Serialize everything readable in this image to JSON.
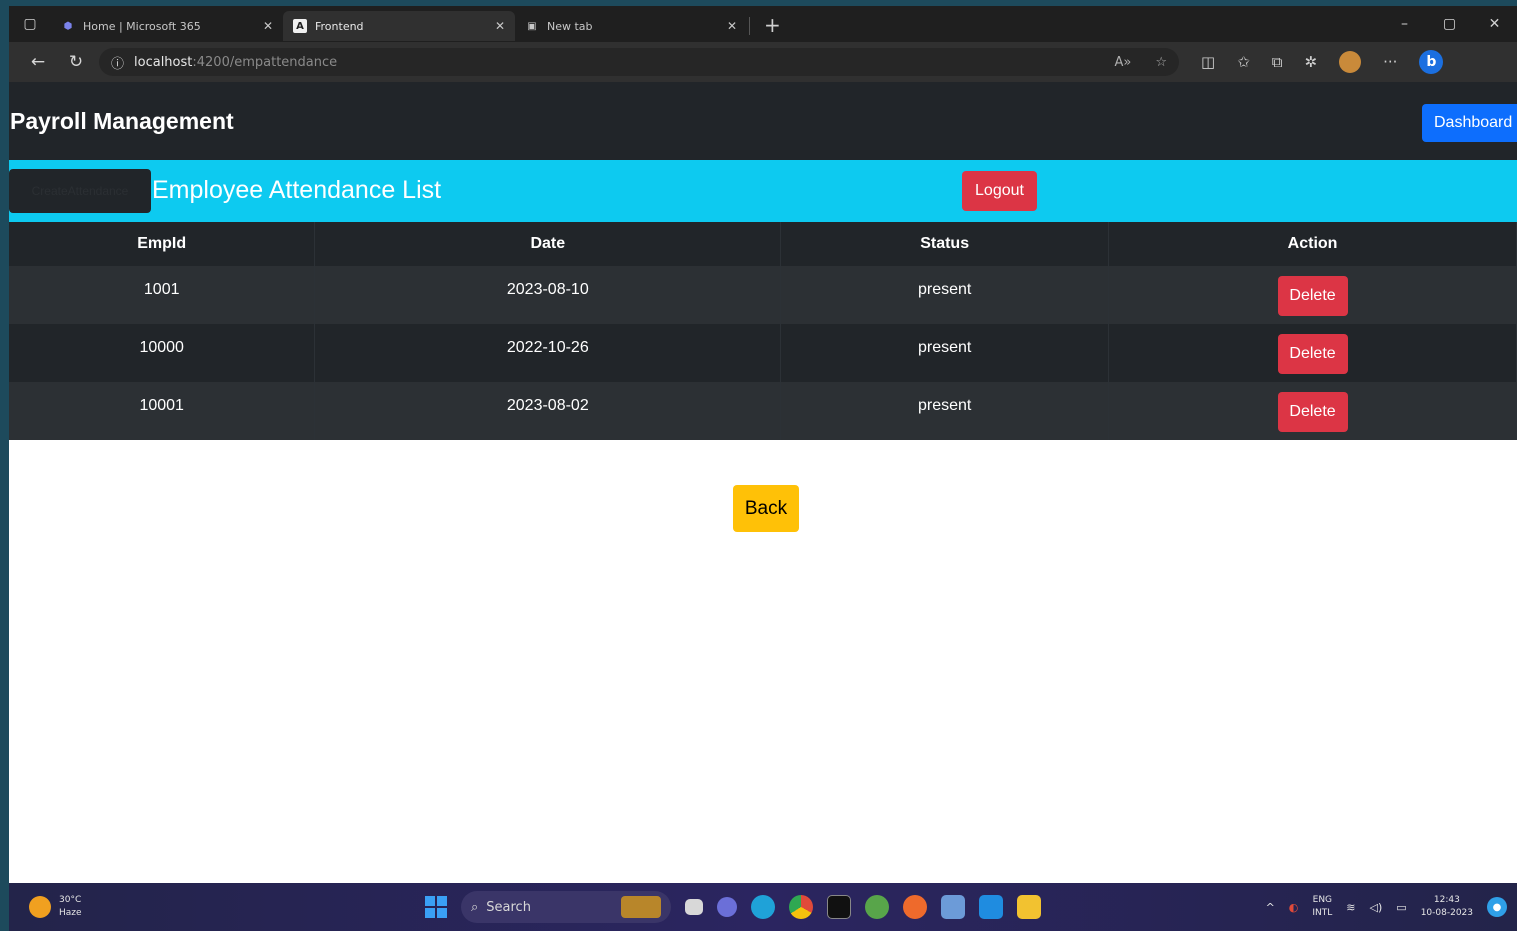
{
  "browser": {
    "tabs": [
      {
        "title": "Home | Microsoft 365",
        "active": false,
        "icon": "m365-icon"
      },
      {
        "title": "Frontend",
        "active": true,
        "icon": "angular-icon"
      },
      {
        "title": "New tab",
        "active": false,
        "icon": "newtab-icon"
      }
    ],
    "url_host": "localhost",
    "url_path": ":4200/empattendance"
  },
  "app": {
    "brand": "Payroll Management",
    "dashboard_label": "Dashboard",
    "create_label": "CreateAttendance",
    "list_title": "Employee Attendance List",
    "logout_label": "Logout",
    "back_label": "Back"
  },
  "table": {
    "headers": [
      "EmpId",
      "Date",
      "Status",
      "Action"
    ],
    "rows": [
      {
        "empid": "1001",
        "date": "2023-08-10",
        "status": "present",
        "action": "Delete"
      },
      {
        "empid": "10000",
        "date": "2022-10-26",
        "status": "present",
        "action": "Delete"
      },
      {
        "empid": "10001",
        "date": "2023-08-02",
        "status": "present",
        "action": "Delete"
      }
    ]
  },
  "taskbar": {
    "temperature": "30°C",
    "weather": "Haze",
    "search_label": "Search",
    "lang_top": "ENG",
    "lang_bottom": "INTL",
    "time": "12:43",
    "date": "10-08-2023"
  },
  "colors": {
    "navbar": "#212529",
    "header_bar": "#0dcaf0",
    "primary": "#0d6efd",
    "danger": "#dc3545",
    "warning": "#ffc107"
  }
}
